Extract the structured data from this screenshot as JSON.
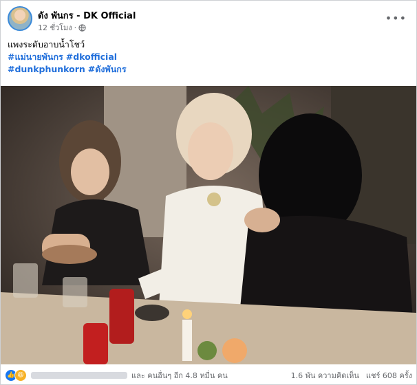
{
  "post": {
    "author": "ดัง พันกร - DK Official",
    "time": "12 ชั่วโมง",
    "privacy_icon": "globe-icon",
    "more_icon": "more-horizontal-icon",
    "caption": "แพงระดับอาบน้ำโชว์",
    "hashtags_line1": [
      "#แม่นายพันกร",
      "#dkofficial"
    ],
    "hashtags_line2": [
      "#dunkphunkorn",
      "#ดังพันกร"
    ]
  },
  "footer": {
    "reaction_icons": [
      "like-icon",
      "haha-icon"
    ],
    "others_text": "และ คนอื่นๆ อีก 4.8 หมื่น คน",
    "comments": "1.6 พัน ความคิดเห็น",
    "shares": "แชร์ 608 ครั้ง"
  },
  "colors": {
    "link": "#216fdb",
    "like": "#1877f2",
    "haha": "#f7b125",
    "muted": "#65676b"
  }
}
